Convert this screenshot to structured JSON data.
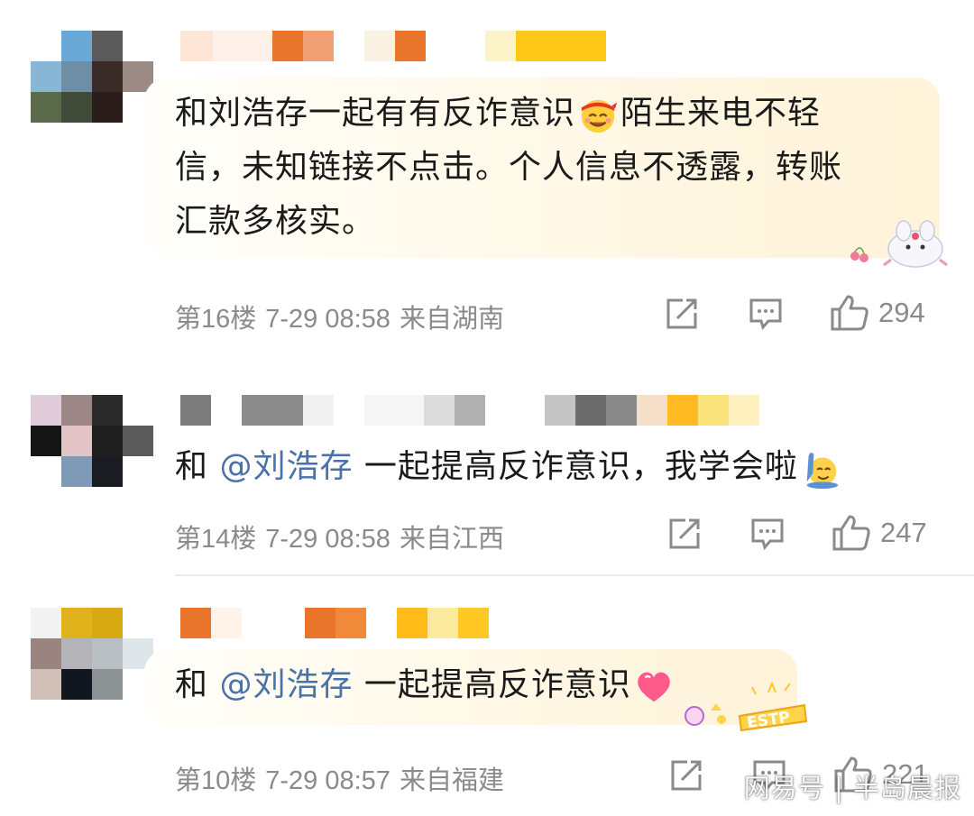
{
  "comments": [
    {
      "text_parts": [
        "和刘浩存一起有有反诈意识",
        "陌生来电不轻",
        "信，未知链接不点击。个人信息不透露，转账",
        "汇款多核实。"
      ],
      "emoji": "smiling-face-with-red-headband",
      "sticker": "bunny-cherry-sticker",
      "floor": "第16楼",
      "time": "7-29 08:58",
      "location": "来自湖南",
      "likes": "294"
    },
    {
      "text_prefix": "和 ",
      "mention": "@刘浩存",
      "text_suffix": " 一起提高反诈意识，我学会啦",
      "emoji": "raising-hand-face",
      "floor": "第14楼",
      "time": "7-29 08:58",
      "location": "来自江西",
      "likes": "247"
    },
    {
      "text_prefix": "和 ",
      "mention": "@刘浩存",
      "text_suffix": " 一起提高反诈意识",
      "emoji": "pink-heart",
      "sticker": "ESTP",
      "floor": "第10楼",
      "time": "7-29 08:57",
      "location": "来自福建",
      "likes": "221"
    }
  ],
  "icons": {
    "share": "share-icon",
    "reply": "comment-icon",
    "like": "thumbs-up-icon"
  },
  "watermark": "网易号 | 半岛晨报",
  "colors": {
    "mention": "#4a72a8",
    "meta": "#8a8a8a",
    "bubble": "#fff6e2"
  }
}
